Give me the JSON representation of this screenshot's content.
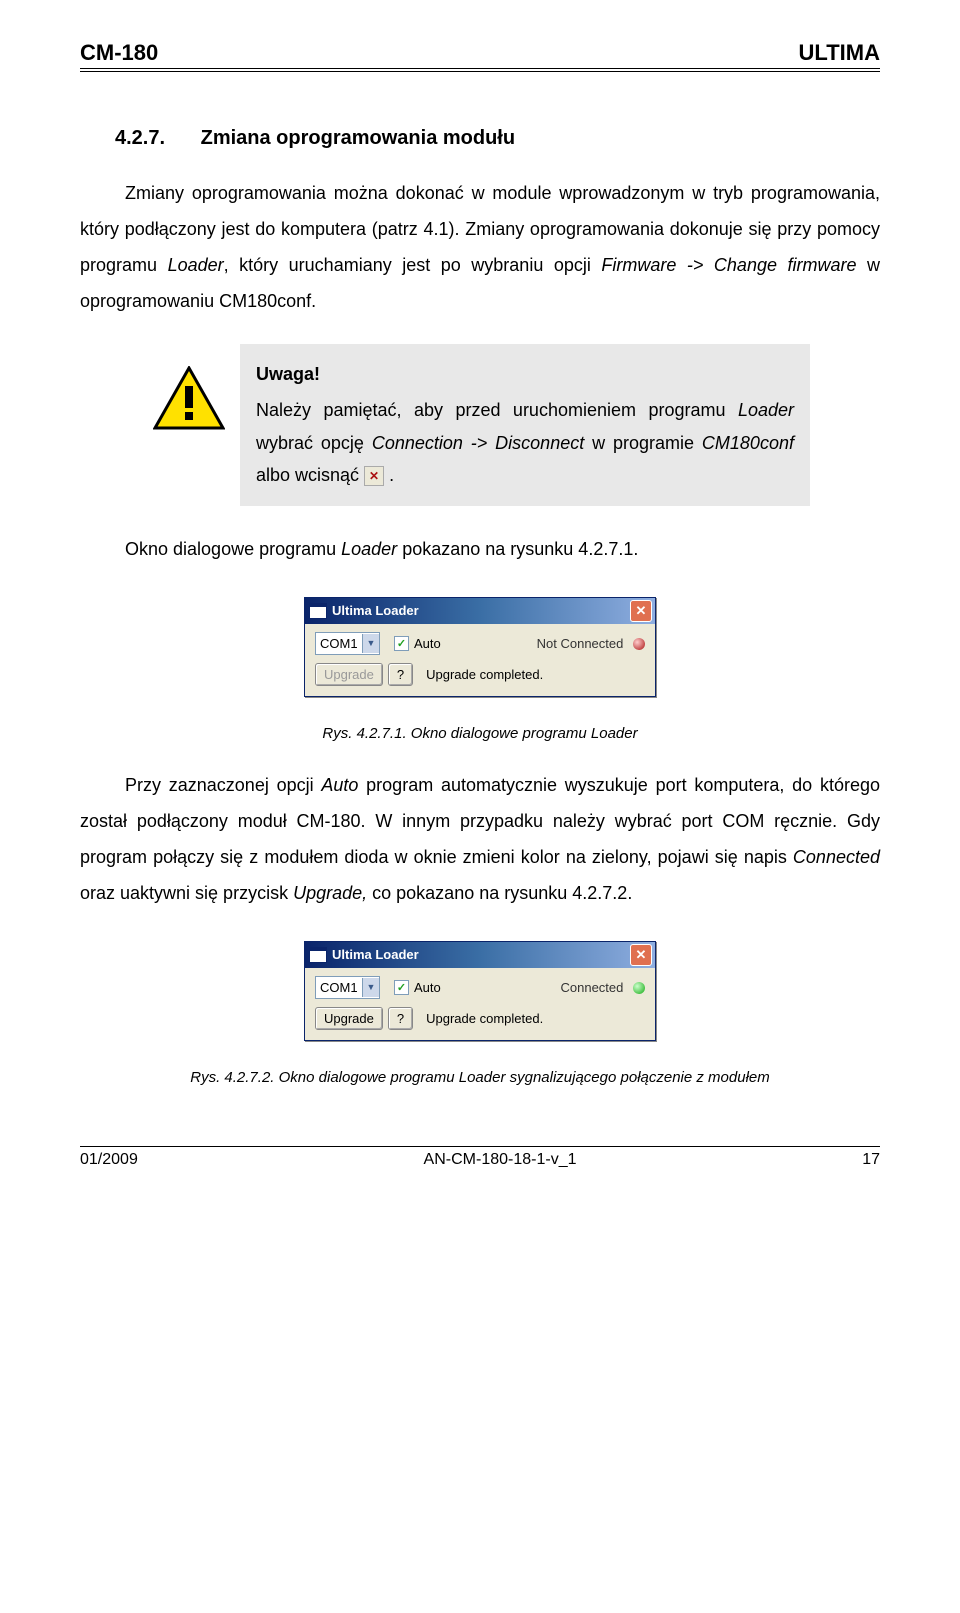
{
  "header": {
    "left": "CM-180",
    "right": "ULTIMA"
  },
  "heading": {
    "num": "4.2.7.",
    "title": "Zmiana oprogramowania modułu"
  },
  "para1_a": "Zmiany oprogramowania można dokonać w module wprowadzonym w tryb programowania, który podłączony jest do komputera (patrz 4.1). Zmiany oprogramowania dokonuje się przy pomocy programu ",
  "para1_b": ", który uruchamiany jest po wybraniu opcji ",
  "para1_c": " w oprogramowaniu CM180conf.",
  "italic_loader": "Loader",
  "italic_firm": "Firmware -> Change firmware",
  "note": {
    "title": "Uwaga!",
    "t1": "Należy pamiętać, aby przed uruchomieniem programu ",
    "t2": " wybrać opcję ",
    "t3": " w programie ",
    "t4": " albo wcisnąć ",
    "period": ".",
    "i_loader": "Loader",
    "i_conn": "Connection -> Disconnect",
    "i_cm": "CM180conf"
  },
  "para2_a": "Okno dialogowe programu ",
  "para2_b": " pokazano na rysunku 4.2.7.1.",
  "dialog1": {
    "title": "Ultima Loader",
    "com": "COM1",
    "auto": "Auto",
    "status": "Not Connected",
    "upgrade": "Upgrade",
    "q": "?",
    "msg": "Upgrade completed."
  },
  "caption1": "Rys. 4.2.7.1. Okno dialogowe programu Loader",
  "para3_a": "Przy zaznaczonej opcji ",
  "para3_b": " program automatycznie wyszukuje port komputera, do którego został podłączony moduł CM-180. W innym przypadku należy wybrać port COM ręcznie. Gdy program połączy się z modułem dioda w oknie zmieni kolor na zielony, pojawi się napis ",
  "para3_c": " oraz uaktywni się przycisk ",
  "para3_d": " co pokazano na rysunku 4.2.7.2.",
  "i_auto": "Auto",
  "i_connected": "Connected",
  "i_upgrade": "Upgrade,",
  "dialog2": {
    "title": "Ultima Loader",
    "com": "COM1",
    "auto": "Auto",
    "status": "Connected",
    "upgrade": "Upgrade",
    "q": "?",
    "msg": "Upgrade completed."
  },
  "caption2": "Rys. 4.2.7.2. Okno dialogowe programu Loader sygnalizującego połączenie z modułem",
  "footer": {
    "left": "01/2009",
    "center": "AN-CM-180-18-1-v_1",
    "right": "17"
  }
}
